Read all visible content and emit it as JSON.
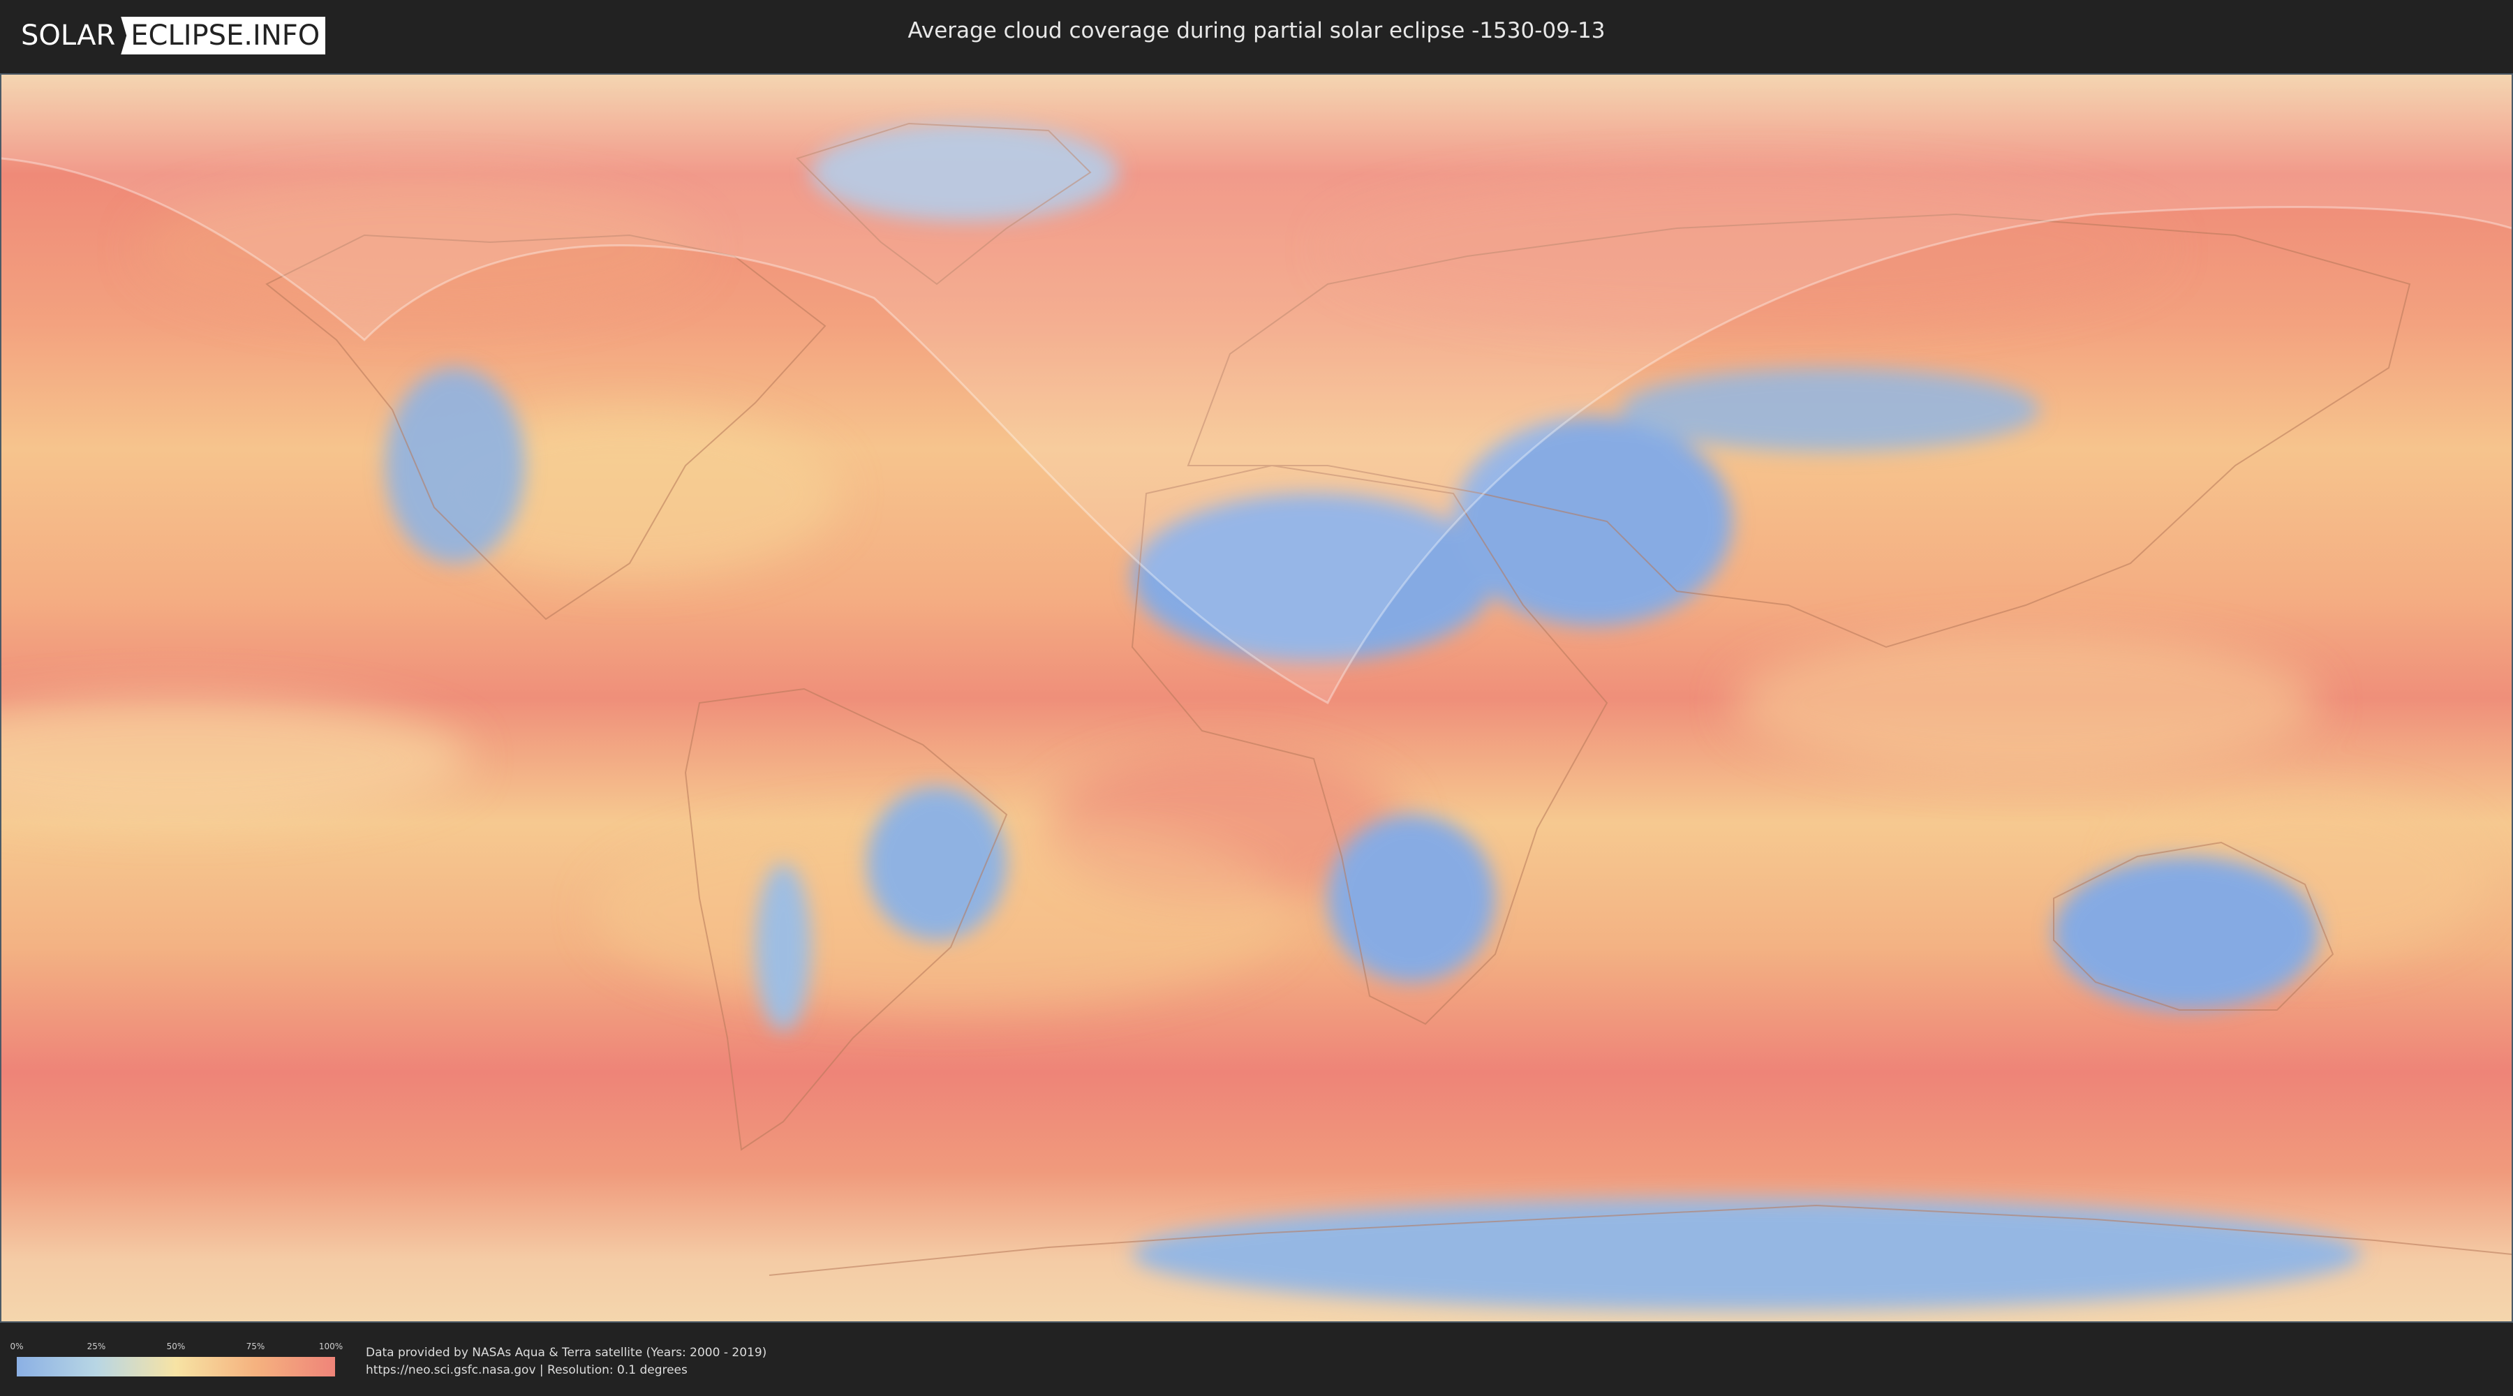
{
  "header": {
    "logo_left": "SOLAR",
    "logo_right": "ECLIPSE.INFO",
    "title": "Average cloud coverage during partial solar eclipse -1530-09-13"
  },
  "map": {
    "colors": {
      "clear": "#8bb0e4",
      "low": "#b8d6e4",
      "mid": "#f7e3a4",
      "high": "#f5b27f",
      "overcast": "#ef8479"
    }
  },
  "legend": {
    "labels": [
      "0%",
      "25%",
      "50%",
      "75%",
      "100%"
    ]
  },
  "credits": {
    "line1": "Data provided by NASAs Aqua & Terra satellite (Years: 2000 - 2019)",
    "line2": "https://neo.sci.gsfc.nasa.gov | Resolution: 0.1 degrees"
  }
}
